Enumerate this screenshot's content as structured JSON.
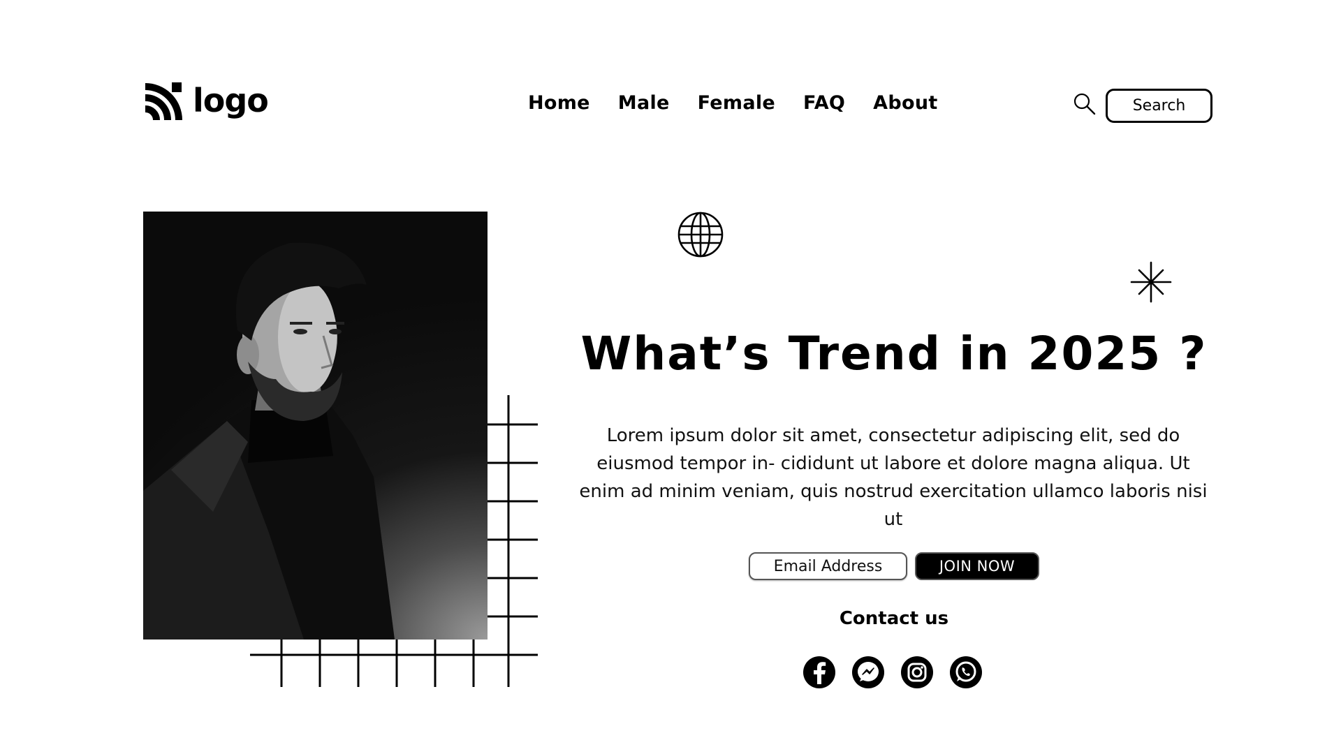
{
  "header": {
    "logo_text": "logo",
    "nav": [
      {
        "label": "Home"
      },
      {
        "label": "Male"
      },
      {
        "label": "Female"
      },
      {
        "label": "FAQ"
      },
      {
        "label": "About"
      }
    ],
    "search_label": "Search"
  },
  "hero": {
    "title": "What’s Trend in 2025 ?",
    "body": "Lorem ipsum dolor sit amet, consectetur adipiscing elit, sed do eiusmod tempor in- cididunt ut labore et dolore magna aliqua. Ut enim ad minim veniam, quis nostrud exercitation ullamco laboris nisi ut",
    "email_placeholder": "Email Address",
    "join_label": "JOIN NOW",
    "contact_label": "Contact us"
  },
  "socials": [
    {
      "icon": "facebook-icon"
    },
    {
      "icon": "messenger-icon"
    },
    {
      "icon": "instagram-icon"
    },
    {
      "icon": "whatsapp-icon"
    }
  ],
  "colors": {
    "background": "#ffffff",
    "foreground": "#000000"
  }
}
